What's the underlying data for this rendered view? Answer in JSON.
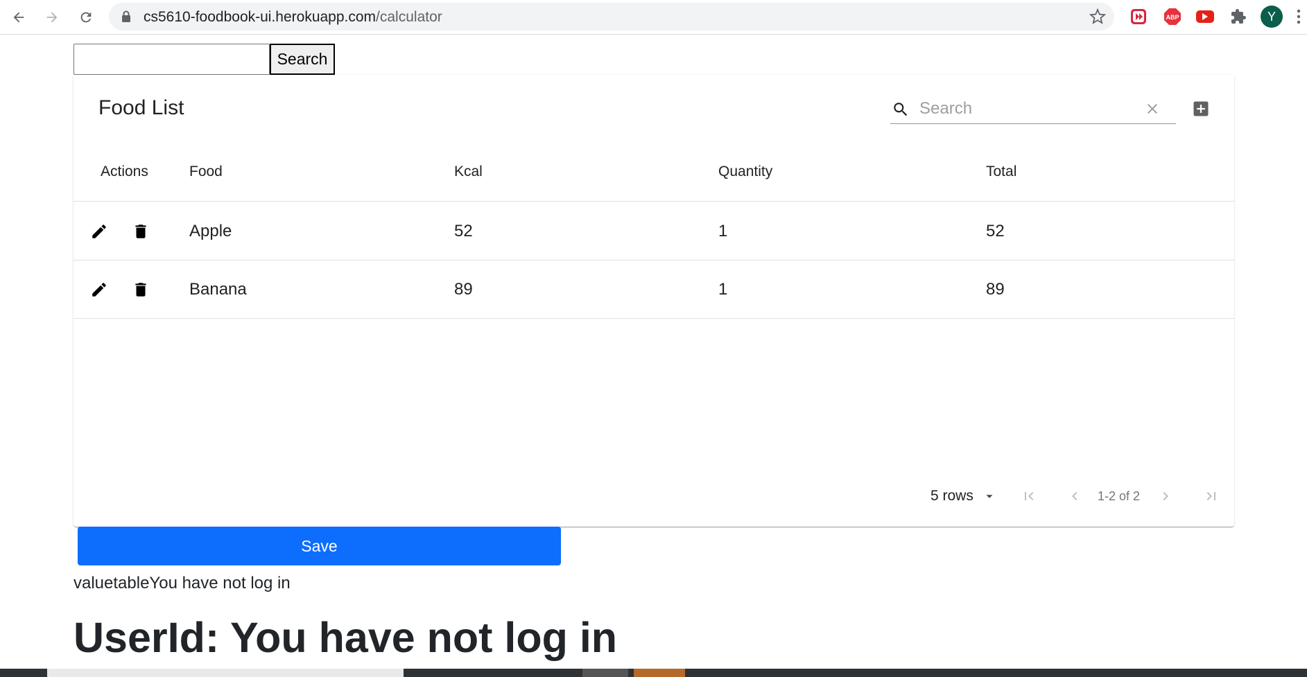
{
  "browser": {
    "url_host": "cs5610-foodbook-ui.herokuapp.com",
    "url_path": "/calculator",
    "avatar_letter": "Y",
    "extension_abp_label": "ABP"
  },
  "top_search": {
    "value": "",
    "button_label": "Search"
  },
  "food_table": {
    "title": "Food List",
    "search_placeholder": "Search",
    "columns": [
      "Actions",
      "Food",
      "Kcal",
      "Quantity",
      "Total"
    ],
    "rows": [
      {
        "food": "Apple",
        "kcal": "52",
        "quantity": "1",
        "total": "52"
      },
      {
        "food": "Banana",
        "kcal": "89",
        "quantity": "1",
        "total": "89"
      }
    ],
    "rows_per_page_label": "5 rows",
    "page_info": "1-2 of 2"
  },
  "save_button_label": "Save",
  "status_text": "valuetableYou have not log in",
  "userid_heading": "UserId: You have not log in",
  "colors": {
    "primary": "#0d6efd",
    "avatar": "#0b5e4b"
  }
}
